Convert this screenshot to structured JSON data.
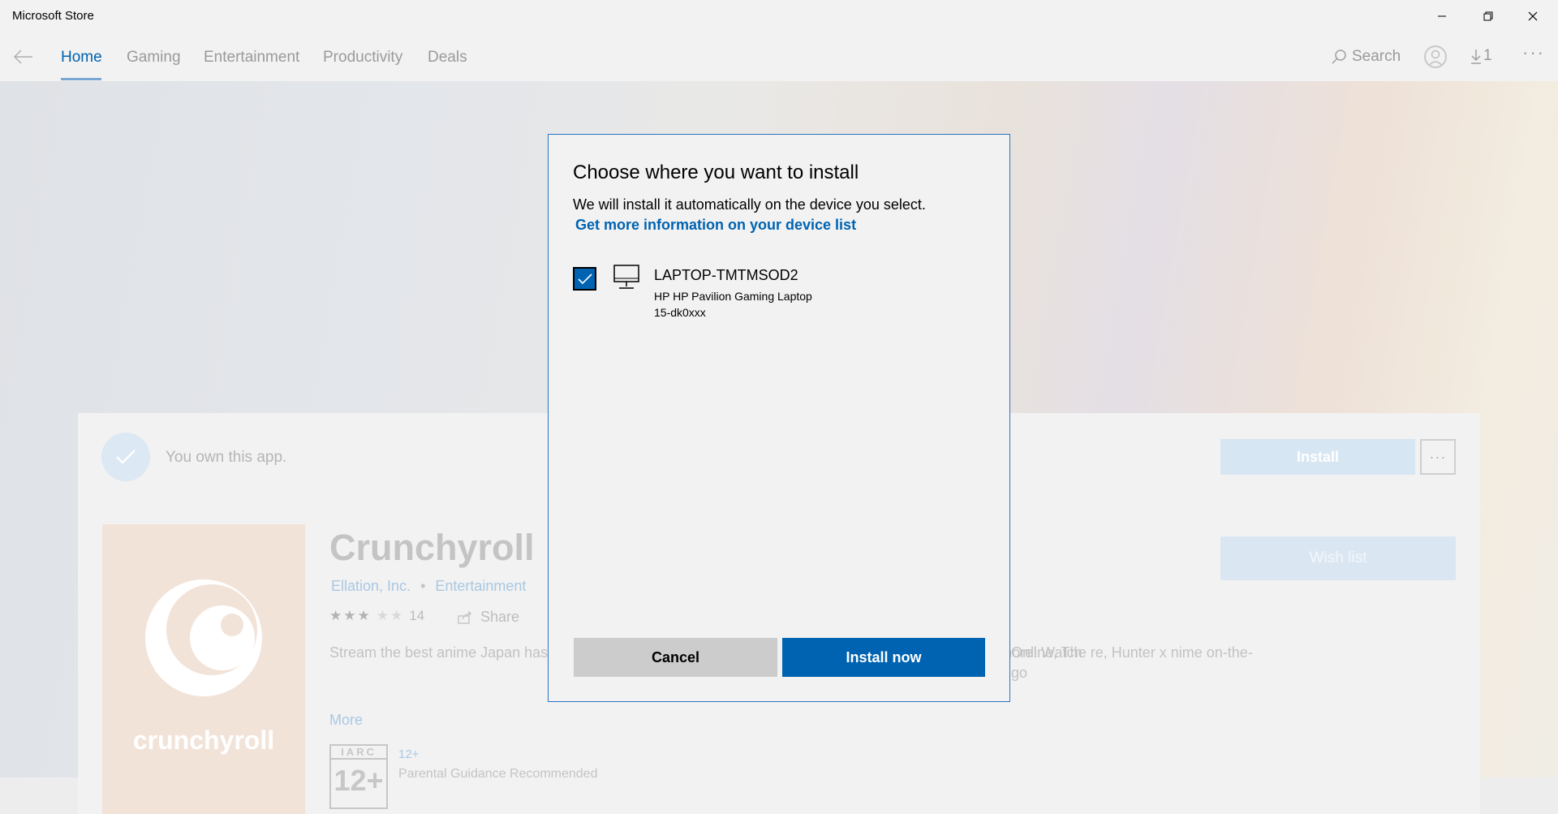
{
  "window": {
    "title": "Microsoft Store"
  },
  "nav": {
    "tabs": [
      "Home",
      "Gaming",
      "Entertainment",
      "Productivity",
      "Deals"
    ],
    "search_label": "Search",
    "downloads_count": "1",
    "more_label": "···"
  },
  "product": {
    "owned_text": "You own this app.",
    "install_label": "Install",
    "more_options": "···",
    "wish_list_label": "Wish list",
    "logo_text": "crunchyroll",
    "title": "Crunchyroll",
    "publisher": "Ellation, Inc.",
    "separator": "•",
    "category": "Entertainment",
    "stars_filled": "★★★",
    "stars_empty": "★★",
    "rating_count": "14",
    "share_label": "Share",
    "description": "Stream the best anime Japan has to offer, including Rising of the Shield, Dragon Ball Hunter, and much more! Watch",
    "description_right": "Online, The re, Hunter x nime on-the-go",
    "more_label": "More",
    "iarc_label": "IARC",
    "iarc_age": "12+",
    "age_rating": "12+",
    "age_rating_desc": "Parental Guidance Recommended"
  },
  "dialog": {
    "title": "Choose where you want to install",
    "subtitle": "We will install it automatically on the device you select.",
    "info_link": "Get more information on your device list",
    "device": {
      "name": "LAPTOP-TMTMSOD2",
      "model": "HP HP Pavilion Gaming Laptop 15-dk0xxx",
      "checked": true
    },
    "cancel_label": "Cancel",
    "install_now_label": "Install now"
  },
  "colors": {
    "accent": "#0063b1",
    "dialog_border": "#2a74c0",
    "cancel_bg": "#cccccc"
  }
}
